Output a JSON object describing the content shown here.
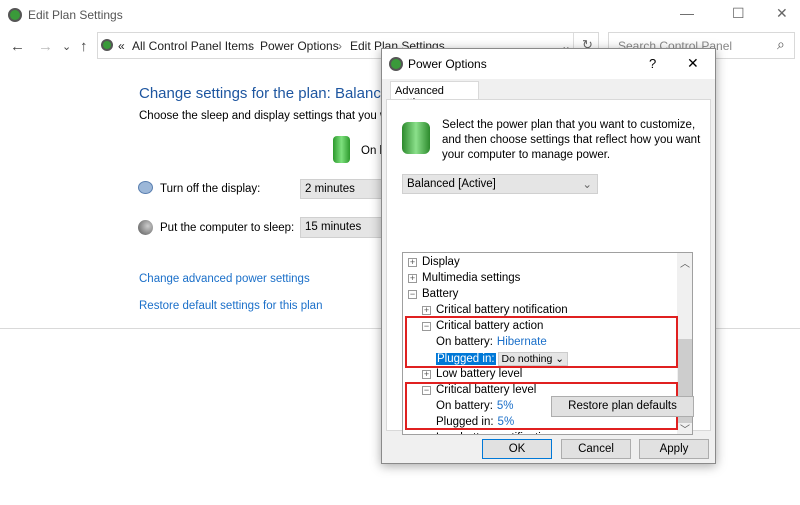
{
  "window": {
    "title": "Edit Plan Settings",
    "minimize": "—",
    "maximize": "☐",
    "close": "✕"
  },
  "nav": {
    "back": "←",
    "forward": "→",
    "recent": "⌄",
    "up": "↑",
    "overflow": "«",
    "breadcrumb": [
      "All Control Panel Items",
      "Power Options",
      "Edit Plan Settings"
    ],
    "sep": "›",
    "dropdown": "⌄",
    "refresh": "↻",
    "search_placeholder": "Search Control Panel",
    "search_icon": "⌕"
  },
  "main": {
    "heading": "Change settings for the plan: Balanced",
    "subtitle": "Choose the sleep and display settings that you want your computer to use.",
    "column_header": "On battery",
    "rows": [
      {
        "label": "Turn off the display:",
        "value": "2 minutes",
        "icon": "display-icon"
      },
      {
        "label": "Put the computer to sleep:",
        "value": "15 minutes",
        "icon": "sleep-moon-icon"
      }
    ],
    "links": [
      "Change advanced power settings",
      "Restore default settings for this plan"
    ]
  },
  "dialog": {
    "title": "Power Options",
    "help": "?",
    "close": "✕",
    "tab": "Advanced settings",
    "description": [
      "Select the power plan that you want to customize,",
      "and then choose settings that reflect how you want",
      "your computer to manage power."
    ],
    "plan": "Balanced [Active]",
    "tree": [
      {
        "label": "Display",
        "level": 0,
        "exp": "+"
      },
      {
        "label": "Multimedia settings",
        "level": 0,
        "exp": "+"
      },
      {
        "label": "Battery",
        "level": 0,
        "exp": "−"
      },
      {
        "label": "Critical battery notification",
        "level": 1,
        "exp": "+"
      },
      {
        "label": "Critical battery action",
        "level": 1,
        "exp": "−"
      },
      {
        "label": "On battery:",
        "level": 2,
        "value": "Hibernate"
      },
      {
        "label": "Plugged in:",
        "level": 2,
        "select": "Do nothing",
        "selected": true
      },
      {
        "label": "Low battery level",
        "level": 1,
        "exp": "+"
      },
      {
        "label": "Critical battery level",
        "level": 1,
        "exp": "−"
      },
      {
        "label": "On battery:",
        "level": 2,
        "value": "5%"
      },
      {
        "label": "Plugged in:",
        "level": 2,
        "value": "5%"
      },
      {
        "label": "Low battery notification",
        "level": 1,
        "exp": "+"
      }
    ],
    "restore": "Restore plan defaults",
    "ok": "OK",
    "cancel": "Cancel",
    "apply": "Apply",
    "highlight_color": "#e02020"
  }
}
